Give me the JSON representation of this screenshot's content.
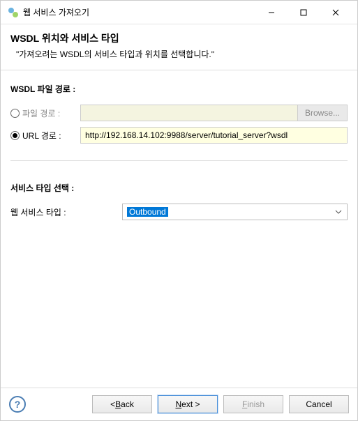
{
  "titlebar": {
    "title": "웹 서비스 가져오기"
  },
  "header": {
    "title": "WSDL 위치와 서비스 타입",
    "subtitle": "\"가져오려는 WSDL의 서비스 타입과 위치를 선택합니다.\""
  },
  "wsdl": {
    "section_label": "WSDL 파일 경로 :",
    "file_radio_label": "파일 경로 :",
    "file_input_value": "",
    "browse_label": "Browse...",
    "url_radio_label": "URL 경로 :",
    "url_input_value": "http://192.168.14.102:9988/server/tutorial_server?wsdl"
  },
  "service": {
    "section_label": "서비스 타입 선택 :",
    "select_label": "웹 서비스 타입 :",
    "select_value": "Outbound"
  },
  "footer": {
    "help": "?",
    "back_prefix": "< ",
    "back_u": "B",
    "back_rest": "ack",
    "next_u": "N",
    "next_rest": "ext >",
    "finish_u": "F",
    "finish_rest": "inish",
    "cancel": "Cancel"
  }
}
